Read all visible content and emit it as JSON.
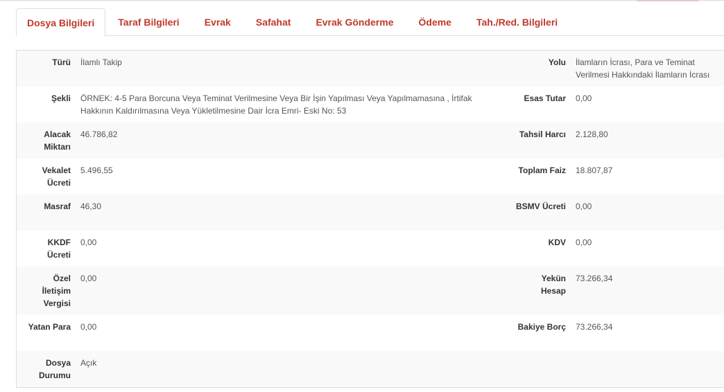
{
  "tabs": [
    {
      "label": "Dosya Bilgileri",
      "active": true
    },
    {
      "label": "Taraf Bilgileri",
      "active": false
    },
    {
      "label": "Evrak",
      "active": false
    },
    {
      "label": "Safahat",
      "active": false
    },
    {
      "label": "Evrak Gönderme",
      "active": false
    },
    {
      "label": "Ödeme",
      "active": false
    },
    {
      "label": "Tah./Red. Bilgileri",
      "active": false
    }
  ],
  "colors": {
    "tab_text": "#c0392b",
    "row_stripe": "#f9f9f9",
    "border": "#dddddd"
  },
  "rows": [
    {
      "left_label": "Türü",
      "left_value": "İlamlı Takip",
      "right_label": "Yolu",
      "right_value": "İlamların İcrası, Para ve Teminat Verilmesi Hakkındaki İlamların İcrası"
    },
    {
      "left_label": "Şekli",
      "left_value": "ÖRNEK: 4-5 Para Borcuna Veya Teminat Verilmesine Veya Bir İşin Yapılması Veya Yapılmamasına , İrtifak Hakkının Kaldırılmasına Veya Yükletilmesine Dair İcra Emri- Eski No: 53",
      "right_label": "Esas Tutar",
      "right_value": "0,00"
    },
    {
      "left_label": "Alacak Miktarı",
      "left_value": "46.786,82",
      "right_label": "Tahsil Harcı",
      "right_value": "2.128,80"
    },
    {
      "left_label": "Vekalet Ücreti",
      "left_value": "5.496,55",
      "right_label": "Toplam Faiz",
      "right_value": "18.807,87"
    },
    {
      "left_label": "Masraf",
      "left_value": "46,30",
      "right_label": "BSMV Ücreti",
      "right_value": "0,00"
    },
    {
      "left_label": "KKDF Ücreti",
      "left_value": "0,00",
      "right_label": "KDV",
      "right_value": "0,00"
    },
    {
      "left_label": "Özel İletişim Vergisi",
      "left_value": "0,00",
      "right_label": "Yekün Hesap",
      "right_value": "73.266,34"
    },
    {
      "left_label": "Yatan Para",
      "left_value": "0,00",
      "right_label": "Bakiye Borç",
      "right_value": "73.266,34"
    },
    {
      "left_label": "Dosya Durumu",
      "left_value": "Açık",
      "right_label": "",
      "right_value": ""
    }
  ]
}
